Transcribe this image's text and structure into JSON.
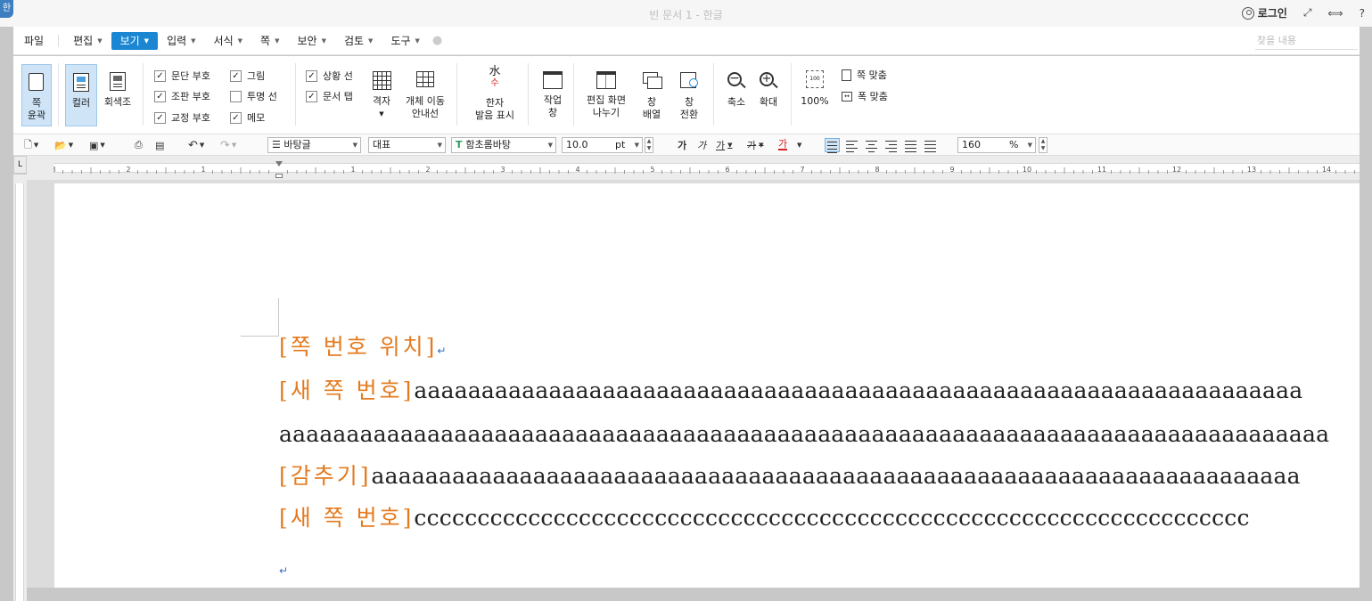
{
  "window": {
    "title": "빈 문서 1 - 한글",
    "app_icon": "한",
    "login": "로그인",
    "controls": [
      "⤢",
      "⟺",
      "?"
    ]
  },
  "menubar": {
    "file": "파일",
    "items": [
      "편집",
      "보기",
      "입력",
      "서식",
      "쪽",
      "보안",
      "검토",
      "도구"
    ],
    "active": "보기",
    "find_placeholder": "찾을 내용"
  },
  "ribbon": {
    "page_outline": [
      "쪽",
      "윤곽"
    ],
    "color": "컬러",
    "grayscale": "회색조",
    "checks": [
      {
        "label": "문단 부호",
        "checked": true
      },
      {
        "label": "조판 부호",
        "checked": true
      },
      {
        "label": "교정 부호",
        "checked": true
      },
      {
        "label": "그림",
        "checked": true
      },
      {
        "label": "투명 선",
        "checked": false
      },
      {
        "label": "메모",
        "checked": true
      },
      {
        "label": "상황 선",
        "checked": true
      },
      {
        "label": "문서 탭",
        "checked": true
      }
    ],
    "grid": "격자",
    "object_guide": [
      "개체 이동",
      "안내선"
    ],
    "hanja": [
      "한자",
      "발음 표시"
    ],
    "task_pane": [
      "작업",
      "창"
    ],
    "split_view": [
      "편집 화면",
      "나누기"
    ],
    "arrange": [
      "창",
      "배열"
    ],
    "switch": [
      "창",
      "전환"
    ],
    "zoom_out": "축소",
    "zoom_in": "확대",
    "zoom_100": "100%",
    "fit_page": "쪽 맞춤",
    "fit_width": "폭 맞춤"
  },
  "format": {
    "style": "바탕글",
    "lang": "대표",
    "font": "함초롬바탕",
    "size": "10.0",
    "unit": "pt",
    "zoom": "160",
    "zoom_unit": "%",
    "char_glyph": "가",
    "colors": {
      "accent": "#1b87d2",
      "font_color_bar": "#d42020",
      "tag": "#e47b1f"
    }
  },
  "ruler": {
    "corner": "L",
    "h_labels": [
      "3",
      "2",
      "1",
      "1",
      "2",
      "3",
      "4",
      "5",
      "6",
      "7",
      "8",
      "9",
      "10",
      "11",
      "12",
      "13",
      "14"
    ]
  },
  "document": {
    "lines": [
      {
        "tag": "[쪽 번호 위치]",
        "text": "",
        "mark": "↵"
      },
      {
        "tag": "[새 쪽 번호]",
        "text": "aaaaaaaaaaaaaaaaaaaaaaaaaaaaaaaaaaaaaaaaaaaaaaaaaaaaaaaaaaaaaaaaaa",
        "mark": ""
      },
      {
        "tag": "",
        "text": "aaaaaaaaaaaaaaaaaaaaaaaaaaaaaaaaaaaaaaaaaaaaaaaaaaaaaaaaaaaaaaaaaaaaaaaaaaaaaa",
        "mark": ""
      },
      {
        "tag": "[감추기]",
        "text": "aaaaaaaaaaaaaaaaaaaaaaaaaaaaaaaaaaaaaaaaaaaaaaaaaaaaaaaaaaaaaaaaaaaaa",
        "mark": ""
      },
      {
        "tag": "[새 쪽 번호]",
        "text": "cccccccccccccccccccccccccccccccccccccccccccccccccccccccccccccccccc",
        "mark": ""
      },
      {
        "tag": "",
        "text": "",
        "mark": "↵"
      }
    ]
  }
}
